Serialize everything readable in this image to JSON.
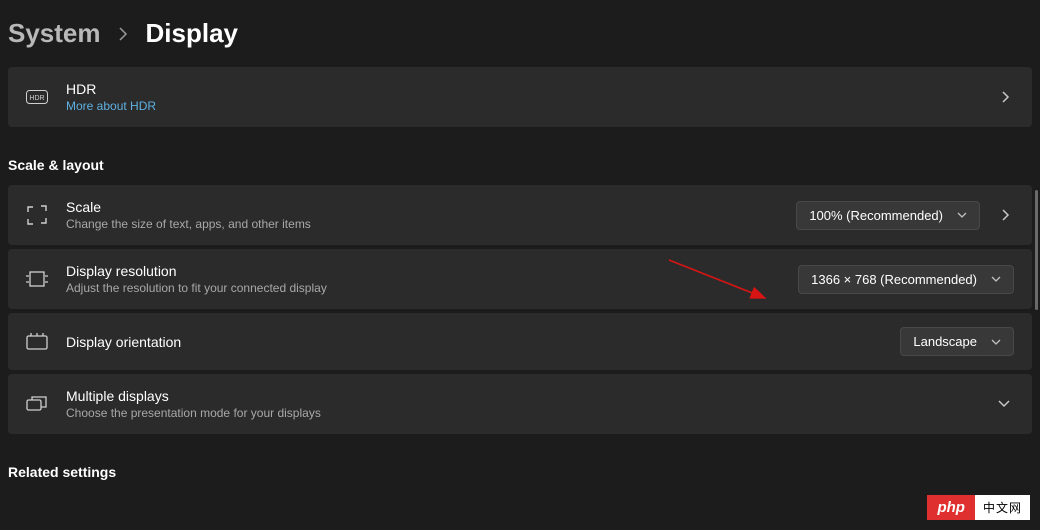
{
  "breadcrumb": {
    "parent": "System",
    "current": "Display"
  },
  "hdr": {
    "title": "HDR",
    "link": "More about HDR"
  },
  "sections": {
    "scale_layout": "Scale & layout",
    "related": "Related settings"
  },
  "scale": {
    "title": "Scale",
    "sub": "Change the size of text, apps, and other items",
    "value": "100% (Recommended)"
  },
  "resolution": {
    "title": "Display resolution",
    "sub": "Adjust the resolution to fit your connected display",
    "value": "1366 × 768 (Recommended)"
  },
  "orientation": {
    "title": "Display orientation",
    "value": "Landscape"
  },
  "multiple": {
    "title": "Multiple displays",
    "sub": "Choose the presentation mode for your displays"
  },
  "watermark": {
    "left": "php",
    "right": "中文网"
  }
}
